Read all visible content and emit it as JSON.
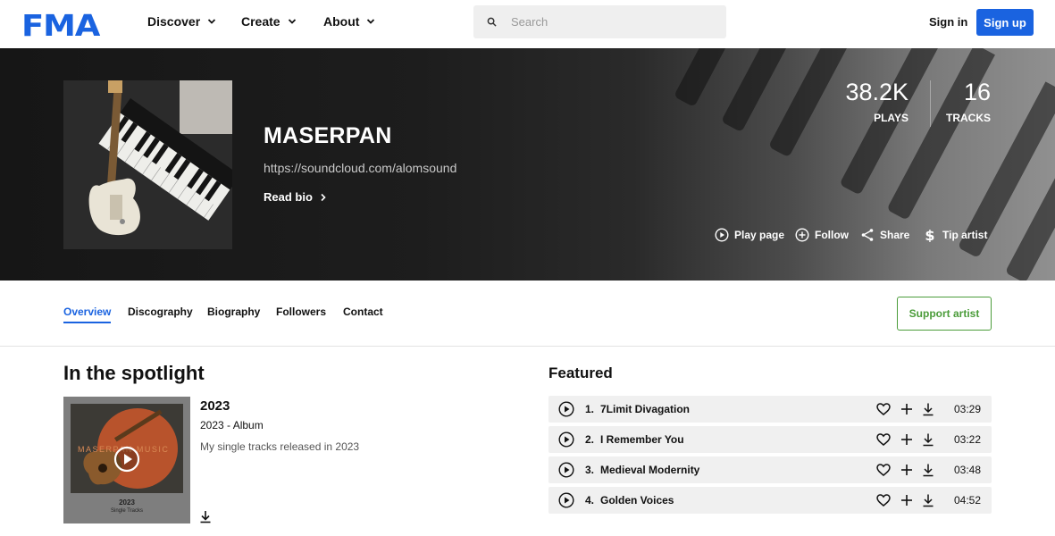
{
  "brand": {
    "logo": "FMA",
    "accent": "#1a63e0",
    "support_color": "#4b9c3a"
  },
  "nav": {
    "items": [
      {
        "label": "Discover"
      },
      {
        "label": "Create"
      },
      {
        "label": "About"
      }
    ],
    "search_placeholder": "Search",
    "signin": "Sign in",
    "signup": "Sign up"
  },
  "artist": {
    "name": "MASERPAN",
    "url": "https://soundcloud.com/alomsound",
    "read_bio": "Read bio",
    "stats": [
      {
        "value": "38.2K",
        "label": "PLAYS"
      },
      {
        "value": "16",
        "label": "TRACKS"
      }
    ],
    "actions": [
      {
        "label": "Play page",
        "icon": "play-circle-icon"
      },
      {
        "label": "Follow",
        "icon": "plus-circle-icon"
      },
      {
        "label": "Share",
        "icon": "share-icon"
      },
      {
        "label": "Tip artist",
        "icon": "dollar-icon"
      }
    ]
  },
  "tabs": [
    "Overview",
    "Discography",
    "Biography",
    "Followers",
    "Contact"
  ],
  "support_button": "Support artist",
  "spotlight": {
    "heading": "In the spotlight",
    "album": {
      "title": "2023",
      "subtitle": "2023 - Album",
      "description": "My single tracks released in 2023",
      "cover_text": "MASERPAN MUSIC",
      "cover_caption": "2023",
      "cover_subcaption": "Single Tracks"
    }
  },
  "featured": {
    "heading": "Featured",
    "tracks": [
      {
        "num": "1.",
        "title": "7Limit Divagation",
        "duration": "03:29"
      },
      {
        "num": "2.",
        "title": "I Remember You",
        "duration": "03:22"
      },
      {
        "num": "3.",
        "title": "Medieval Modernity",
        "duration": "03:48"
      },
      {
        "num": "4.",
        "title": "Golden Voices",
        "duration": "04:52"
      }
    ]
  }
}
